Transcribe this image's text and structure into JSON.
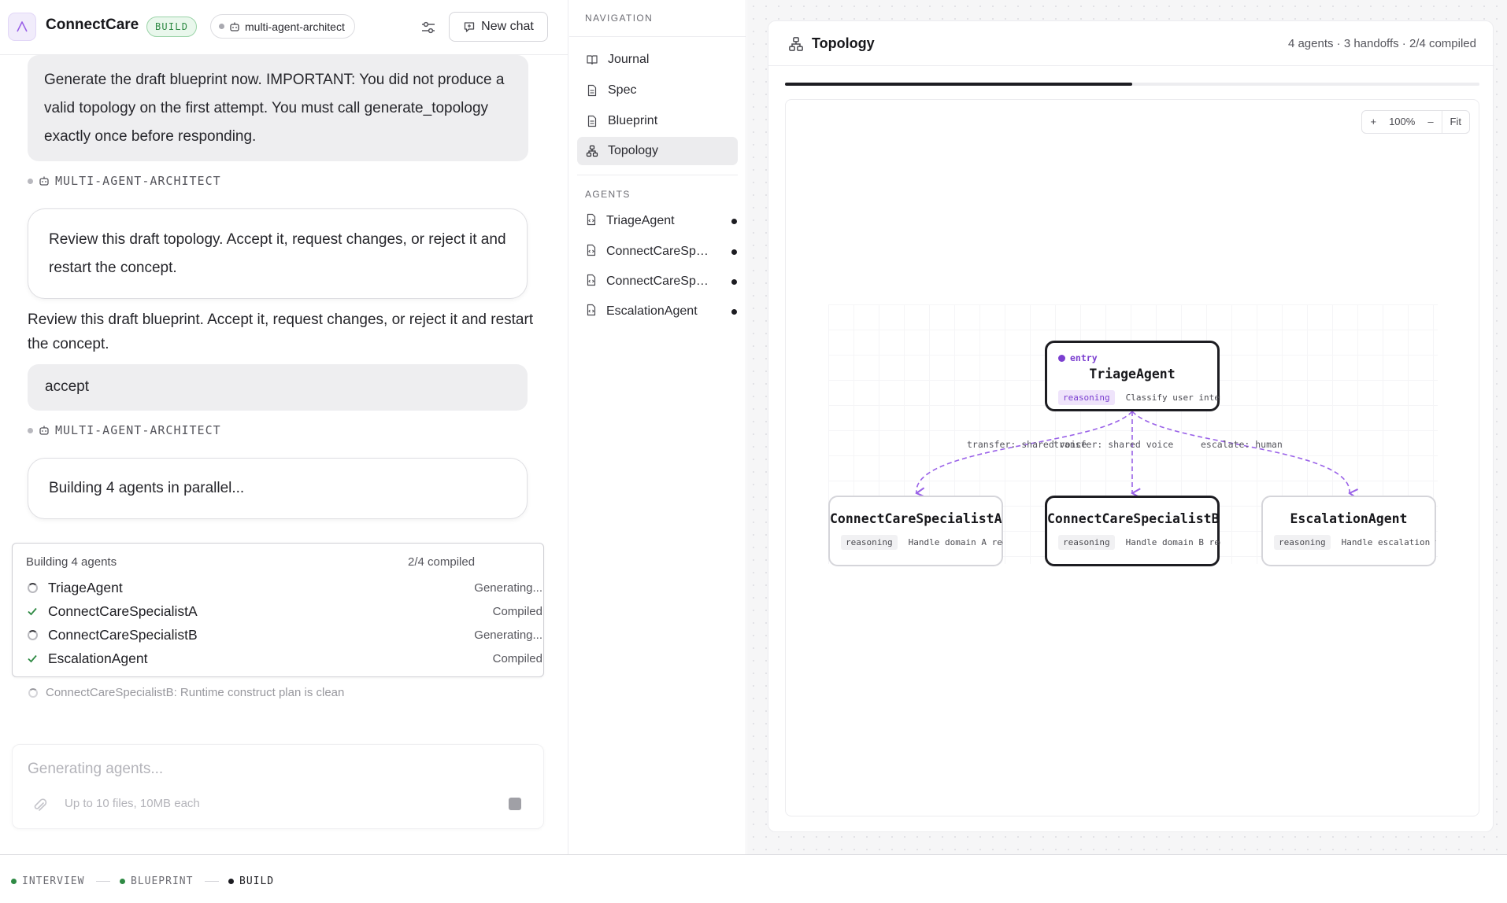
{
  "app": {
    "name": "ConnectCare",
    "mode_badge": "BUILD",
    "agent_chip": "multi-agent-architect",
    "new_chat_label": "New chat"
  },
  "chat": {
    "messages": [
      {
        "role": "user",
        "text": "Generate the draft blueprint now. IMPORTANT: You did not produce a valid topology on the first attempt. You must call generate_topology exactly once before responding."
      },
      {
        "role": "assistant",
        "sender": "MULTI-AGENT-ARCHITECT",
        "bubble": "Review this draft topology. Accept it, request changes, or reject it and restart the concept.",
        "followup": "Review this draft blueprint. Accept it, request changes, or reject it and restart the concept."
      },
      {
        "role": "user",
        "text": "accept"
      },
      {
        "role": "assistant",
        "sender": "MULTI-AGENT-ARCHITECT",
        "bubble": "Building 4 agents in parallel..."
      }
    ],
    "build_card": {
      "title": "Building 4 agents",
      "count": "2/4 compiled",
      "rows": [
        {
          "name": "TriageAgent",
          "state": "Generating...",
          "done": false
        },
        {
          "name": "ConnectCareSpecialistA",
          "state": "Compiled",
          "done": true
        },
        {
          "name": "ConnectCareSpecialistB",
          "state": "Generating...",
          "done": false
        },
        {
          "name": "EscalationAgent",
          "state": "Compiled",
          "done": true
        }
      ]
    },
    "status_line": "ConnectCareSpecialistB: Runtime construct plan is clean",
    "composer": {
      "placeholder": "Generating agents...",
      "attach_hint": "Up to 10 files, 10MB each"
    }
  },
  "navigation": {
    "heading": "NAVIGATION",
    "items": [
      {
        "label": "Journal",
        "icon": "book-icon",
        "active": false
      },
      {
        "label": "Spec",
        "icon": "document-icon",
        "active": false
      },
      {
        "label": "Blueprint",
        "icon": "document-icon",
        "active": false
      },
      {
        "label": "Topology",
        "icon": "topology-icon",
        "active": true
      }
    ],
    "agents_heading": "AGENTS",
    "agents": [
      {
        "label": "TriageAgent"
      },
      {
        "label": "ConnectCareSpecialistA"
      },
      {
        "label": "ConnectCareSpecialistB"
      },
      {
        "label": "EscalationAgent"
      }
    ]
  },
  "topology": {
    "title": "Topology",
    "stats": "4 agents · 3 handoffs · 2/4 compiled",
    "progress": 0.5,
    "zoom": {
      "plus": "+",
      "level": "100%",
      "minus": "–",
      "fit": "Fit"
    },
    "nodes": [
      {
        "name": "TriageAgent",
        "entry_label": "entry",
        "tag": "reasoning",
        "desc": "Classify user intent",
        "compiled": false
      },
      {
        "name": "ConnectCareSpecialistA",
        "tag": "reasoning",
        "desc": "Handle domain A requ",
        "compiled": true
      },
      {
        "name": "ConnectCareSpecialistB",
        "tag": "reasoning",
        "desc": "Handle domain B requ",
        "compiled": false
      },
      {
        "name": "EscalationAgent",
        "tag": "reasoning",
        "desc": "Handle escalation to",
        "compiled": true
      }
    ],
    "edges": [
      {
        "from": "TriageAgent",
        "to": "ConnectCareSpecialistA",
        "label": "transfer: shared voice"
      },
      {
        "from": "TriageAgent",
        "to": "ConnectCareSpecialistB",
        "label": "transfer: shared voice"
      },
      {
        "from": "TriageAgent",
        "to": "EscalationAgent",
        "label": "escalate: human"
      }
    ],
    "edge_color": "#9a62e8"
  },
  "stepper": {
    "steps": [
      {
        "label": "INTERVIEW",
        "done": true
      },
      {
        "label": "BLUEPRINT",
        "done": true
      },
      {
        "label": "BUILD",
        "done": false,
        "current": true
      }
    ]
  },
  "colors": {
    "accent": "#7b3fd0",
    "success": "#2f8a44",
    "dark": "#1d1d22"
  }
}
